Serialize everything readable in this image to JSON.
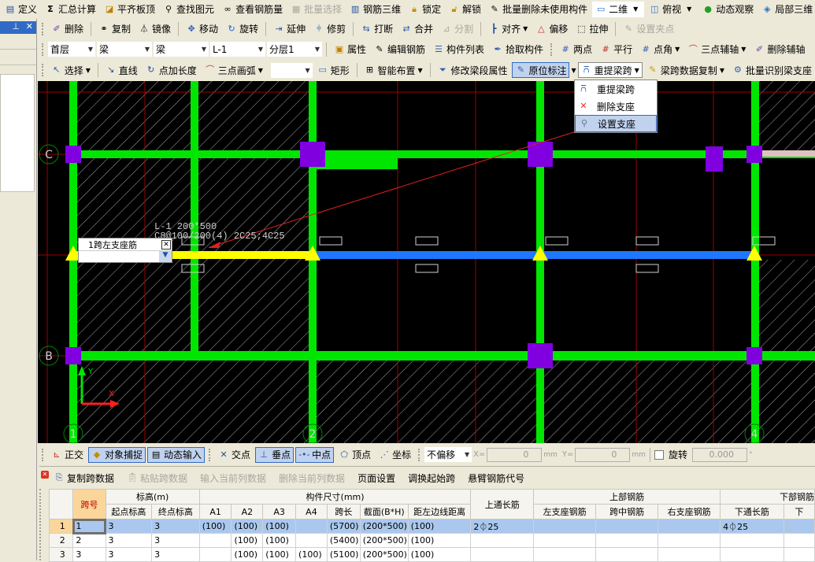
{
  "toolbar1": [
    "定义",
    "汇总计算",
    "平齐板顶",
    "查找图元",
    "查看钢筋量",
    "批量选择",
    "钢筋三维",
    "锁定",
    "解锁",
    "批量删除未使用构件",
    "二维",
    "俯视",
    "动态观察",
    "局部三维"
  ],
  "toolbar2": [
    "删除",
    "复制",
    "镜像",
    "移动",
    "旋转",
    "延伸",
    "修剪",
    "打断",
    "合并",
    "分割",
    "对齐",
    "偏移",
    "拉伸",
    "设置夹点"
  ],
  "toolbar3": {
    "floor": "首层",
    "type1": "梁",
    "type2": "梁",
    "component": "L-1",
    "layer": "分层1",
    "items": [
      "属性",
      "编辑钢筋",
      "构件列表",
      "拾取构件",
      "两点",
      "平行",
      "点角",
      "三点辅轴",
      "删除辅轴"
    ]
  },
  "toolbar4": [
    "选择",
    "直线",
    "点加长度",
    "三点画弧",
    "矩形",
    "智能布置",
    "修改梁段属性",
    "原位标注",
    "重提梁跨",
    "梁跨数据复制",
    "批量识别梁支座"
  ],
  "dropdown_menu": [
    "重提梁跨",
    "删除支座",
    "设置支座"
  ],
  "canvas": {
    "axis_labels": [
      "C",
      "B",
      "1",
      "2",
      "4"
    ],
    "beam_label_1": "L-1 200*500",
    "beam_label_2": "C8@100/200(4) 2C25;4C25",
    "popup_title": "1跨左支座筋",
    "popup_value": "",
    "ucs_x": "X",
    "ucs_y": "Y"
  },
  "snapbar": {
    "items": [
      "正交",
      "对象捕捉",
      "动态输入",
      "交点",
      "垂点",
      "中点",
      "顶点",
      "坐标"
    ],
    "offset_mode": "不偏移",
    "x_label": "X=",
    "x_value": "0",
    "y_label": "Y=",
    "y_value": "0",
    "unit": "mm",
    "rotate_label": "旋转",
    "rotate_value": "0.000",
    "deg": "°"
  },
  "panel_toolbar": [
    "复制跨数据",
    "粘贴跨数据",
    "输入当前列数据",
    "删除当前列数据",
    "页面设置",
    "调换起始跨",
    "悬臂钢筋代号"
  ],
  "table": {
    "group_headers": [
      "跨号",
      "标高(m)",
      "构件尺寸(mm)",
      "上通长筋",
      "上部钢筋",
      "下部钢筋"
    ],
    "sub_headers": [
      "起点标高",
      "终点标高",
      "A1",
      "A2",
      "A3",
      "A4",
      "跨长",
      "截面(B*H)",
      "距左边线距离",
      "左支座钢筋",
      "跨中钢筋",
      "右支座钢筋",
      "下通长筋",
      "下"
    ],
    "rows": [
      [
        "1",
        "1",
        "3",
        "3",
        "(100)",
        "(100)",
        "(100)",
        "",
        "(5700)",
        "(200*500)",
        "(100)",
        "2⏀25",
        "",
        "",
        "",
        "4⏀25",
        ""
      ],
      [
        "2",
        "2",
        "3",
        "3",
        "",
        "(100)",
        "(100)",
        "",
        "(5400)",
        "(200*500)",
        "(100)",
        "",
        "",
        "",
        "",
        "",
        ""
      ],
      [
        "3",
        "3",
        "3",
        "3",
        "",
        "(100)",
        "(100)",
        "(100)",
        "(5100)",
        "(200*500)",
        "(100)",
        "",
        "",
        "",
        "",
        "",
        ""
      ]
    ]
  },
  "colors": {
    "beam": "#00e600",
    "selected_beam": "#ffff00",
    "other_beam": "#1e78ff",
    "column": "#8000e0",
    "grid": "#a00000",
    "selection": "#316ac5"
  }
}
